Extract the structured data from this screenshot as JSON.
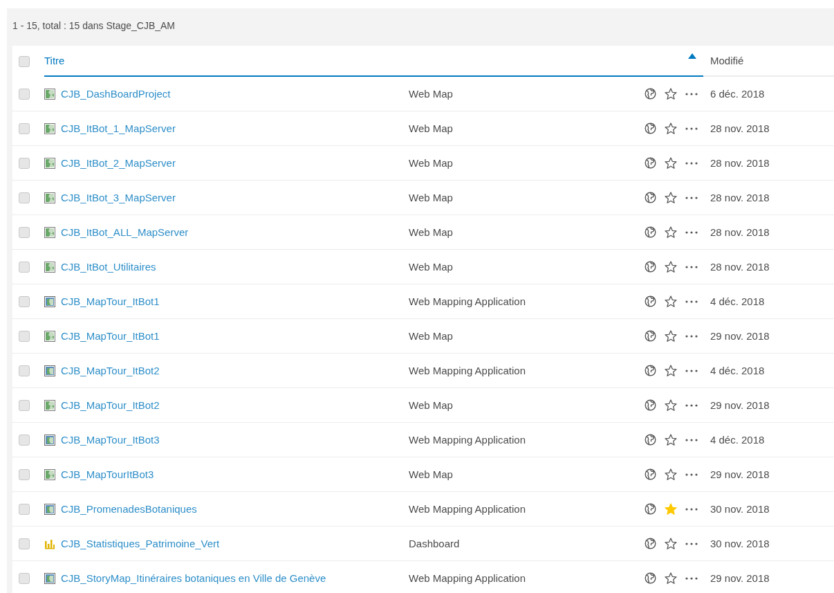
{
  "summary": "1 - 15, total : 15 dans Stage_CJB_AM",
  "columns": {
    "title": {
      "label": "Titre",
      "sorted": true,
      "sort_ascending": true
    },
    "modified": {
      "label": "Modifié"
    }
  },
  "select_all": {
    "checked": false
  },
  "rows": [
    {
      "title": "CJB_DashBoardProject",
      "kind": "map",
      "type": "Web Map",
      "favorite": false,
      "checked": false,
      "modified": "6 déc. 2018"
    },
    {
      "title": "CJB_ItBot_1_MapServer",
      "kind": "map",
      "type": "Web Map",
      "favorite": false,
      "checked": false,
      "modified": "28 nov. 2018"
    },
    {
      "title": "CJB_ItBot_2_MapServer",
      "kind": "map",
      "type": "Web Map",
      "favorite": false,
      "checked": false,
      "modified": "28 nov. 2018"
    },
    {
      "title": "CJB_ItBot_3_MapServer",
      "kind": "map",
      "type": "Web Map",
      "favorite": false,
      "checked": false,
      "modified": "28 nov. 2018"
    },
    {
      "title": "CJB_ItBot_ALL_MapServer",
      "kind": "map",
      "type": "Web Map",
      "favorite": false,
      "checked": false,
      "modified": "28 nov. 2018"
    },
    {
      "title": "CJB_ItBot_Utilitaires",
      "kind": "map",
      "type": "Web Map",
      "favorite": false,
      "checked": false,
      "modified": "28 nov. 2018"
    },
    {
      "title": "CJB_MapTour_ItBot1",
      "kind": "app",
      "type": "Web Mapping Application",
      "favorite": false,
      "checked": false,
      "modified": "4 déc. 2018"
    },
    {
      "title": "CJB_MapTour_ItBot1",
      "kind": "map",
      "type": "Web Map",
      "favorite": false,
      "checked": false,
      "modified": "29 nov. 2018"
    },
    {
      "title": "CJB_MapTour_ItBot2",
      "kind": "app",
      "type": "Web Mapping Application",
      "favorite": false,
      "checked": false,
      "modified": "4 déc. 2018"
    },
    {
      "title": "CJB_MapTour_ItBot2",
      "kind": "map",
      "type": "Web Map",
      "favorite": false,
      "checked": false,
      "modified": "29 nov. 2018"
    },
    {
      "title": "CJB_MapTour_ItBot3",
      "kind": "app",
      "type": "Web Mapping Application",
      "favorite": false,
      "checked": false,
      "modified": "4 déc. 2018"
    },
    {
      "title": "CJB_MapTourItBot3",
      "kind": "map",
      "type": "Web Map",
      "favorite": false,
      "checked": false,
      "modified": "29 nov. 2018"
    },
    {
      "title": "CJB_PromenadesBotaniques",
      "kind": "app",
      "type": "Web Mapping Application",
      "favorite": true,
      "checked": false,
      "modified": "30 nov. 2018"
    },
    {
      "title": "CJB_Statistiques_Patrimoine_Vert",
      "kind": "dashboard",
      "type": "Dashboard",
      "favorite": false,
      "checked": false,
      "modified": "30 nov. 2018"
    },
    {
      "title": "CJB_StoryMap_Itinéraires botaniques en Ville de Genève",
      "kind": "app",
      "type": "Web Mapping Application",
      "favorite": false,
      "checked": false,
      "modified": "29 nov. 2018"
    }
  ]
}
